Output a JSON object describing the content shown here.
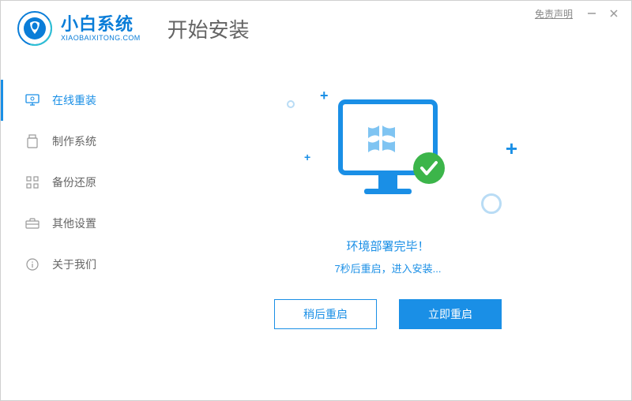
{
  "titlebar": {
    "disclaimer": "免责声明"
  },
  "brand": {
    "name": "小白系统",
    "sub": "XIAOBAIXITONG.COM"
  },
  "page_title": "开始安装",
  "sidebar": {
    "items": [
      {
        "label": "在线重装",
        "icon": "monitor-icon"
      },
      {
        "label": "制作系统",
        "icon": "usb-icon"
      },
      {
        "label": "备份还原",
        "icon": "grid-icon"
      },
      {
        "label": "其他设置",
        "icon": "toolbox-icon"
      },
      {
        "label": "关于我们",
        "icon": "info-icon"
      }
    ]
  },
  "main": {
    "status_title": "环境部署完毕！",
    "status_sub": "7秒后重启，进入安装...",
    "later_button": "稍后重启",
    "now_button": "立即重启"
  },
  "colors": {
    "primary": "#1a8fe6",
    "success": "#3cb54a"
  }
}
